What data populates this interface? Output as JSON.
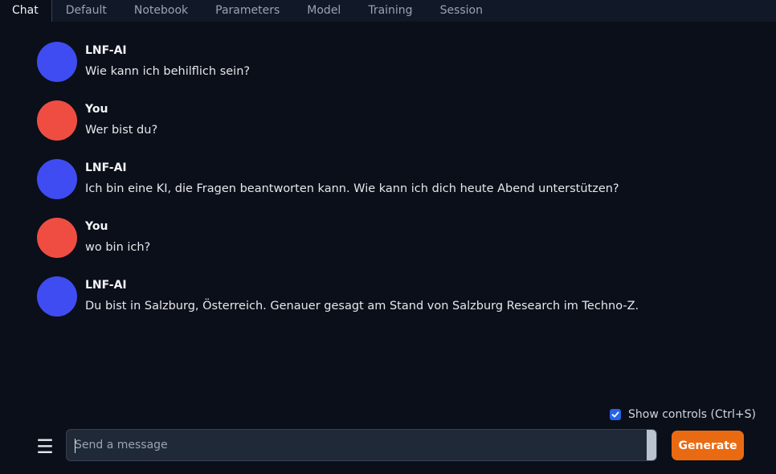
{
  "tabs": [
    {
      "label": "Chat",
      "active": true
    },
    {
      "label": "Default"
    },
    {
      "label": "Notebook"
    },
    {
      "label": "Parameters"
    },
    {
      "label": "Model"
    },
    {
      "label": "Training"
    },
    {
      "label": "Session"
    }
  ],
  "messages": [
    {
      "role": "ai",
      "name": "LNF-AI",
      "text": "Wie kann ich behilflich sein?"
    },
    {
      "role": "user",
      "name": "You",
      "text": "Wer bist du?"
    },
    {
      "role": "ai",
      "name": "LNF-AI",
      "text": "Ich bin eine KI, die Fragen beantworten kann. Wie kann ich dich heute Abend unterstützen?"
    },
    {
      "role": "user",
      "name": "You",
      "text": "wo bin ich?"
    },
    {
      "role": "ai",
      "name": "LNF-AI",
      "text": "Du bist in Salzburg, Österreich. Genauer gesagt am Stand von Salzburg Research im Techno-Z."
    }
  ],
  "controls": {
    "show_controls_label": "Show controls (Ctrl+S)",
    "show_controls_checked": true
  },
  "composer": {
    "menu_icon": "hamburger-menu-icon",
    "placeholder": "Send a message",
    "value": "",
    "generate_label": "Generate"
  },
  "colors": {
    "background": "#0b0f19",
    "ai_avatar": "#3f4cf2",
    "user_avatar": "#ef4d42",
    "accent": "#ea6a12",
    "checkbox": "#2563eb"
  }
}
